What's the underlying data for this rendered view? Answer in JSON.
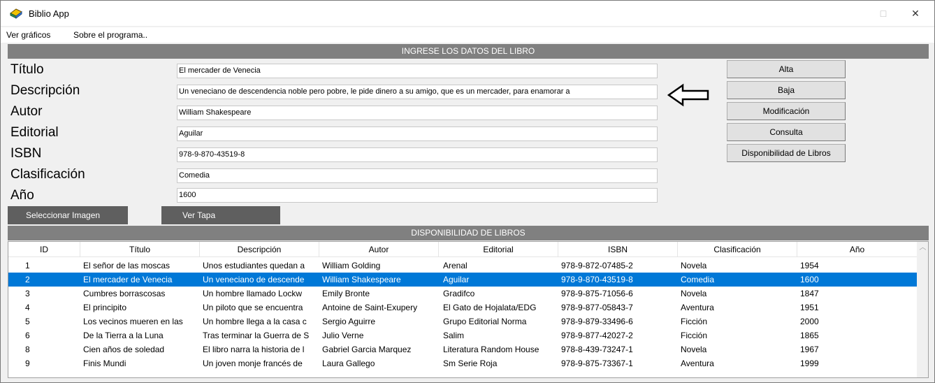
{
  "window": {
    "title": "Biblio App",
    "maximize_glyph": "□",
    "close_glyph": "✕"
  },
  "menu": [
    "Ver gráficos",
    "Sobre el programa.."
  ],
  "form": {
    "header": "INGRESE LOS DATOS DEL LIBRO",
    "fields": [
      {
        "label": "Título",
        "value": "El mercader de Venecia"
      },
      {
        "label": "Descripción",
        "value": "Un veneciano de descendencia noble pero pobre, le pide dinero a su amigo, que es un mercader, para enamorar a"
      },
      {
        "label": "Autor",
        "value": "William Shakespeare"
      },
      {
        "label": "Editorial",
        "value": "Aguilar"
      },
      {
        "label": "ISBN",
        "value": "978-9-870-43519-8"
      },
      {
        "label": "Clasificación",
        "value": "Comedia"
      },
      {
        "label": "Año",
        "value": "1600"
      }
    ],
    "actions": [
      "Alta",
      "Baja",
      "Modificación",
      "Consulta",
      "Disponibilidad de Libros"
    ],
    "select_image_label": "Seleccionar Imagen",
    "view_cover_label": "Ver Tapa"
  },
  "table": {
    "header": "DISPONIBILIDAD DE LIBROS",
    "columns": [
      "ID",
      "Título",
      "Descripción",
      "Autor",
      "Editorial",
      "ISBN",
      "Clasificación",
      "Año"
    ],
    "selected_index": 1,
    "rows": [
      [
        "1",
        "El señor de las moscas",
        "Unos estudiantes quedan a",
        "William Golding",
        "Arenal",
        "978-9-872-07485-2",
        "Novela",
        "1954"
      ],
      [
        "2",
        "El mercader de Venecia",
        "Un veneciano de descende",
        "William Shakespeare",
        "Aguilar",
        "978-9-870-43519-8",
        "Comedia",
        "1600"
      ],
      [
        "3",
        "Cumbres borrascosas",
        "Un hombre llamado Lockw",
        "Emily Bronte",
        "Gradifco",
        "978-9-875-71056-6",
        "Novela",
        "1847"
      ],
      [
        "4",
        "El principito",
        "Un piloto que se encuentra",
        "Antoine de Saint-Exupery",
        "El Gato de Hojalata/EDG",
        "978-9-877-05843-7",
        "Aventura",
        "1951"
      ],
      [
        "5",
        "Los vecinos mueren en las",
        "Un hombre llega a la casa c",
        "Sergio Aguirre",
        "Grupo Editorial Norma",
        "978-9-879-33496-6",
        "Ficción",
        "2000"
      ],
      [
        "6",
        "De la Tierra a la Luna",
        "Tras terminar la Guerra de S",
        "Julio Verne",
        "Salim",
        "978-9-877-42027-2",
        "Ficción",
        "1865"
      ],
      [
        "8",
        "Cien años de soledad",
        "El libro narra la historia de l",
        "Gabriel Garcia Marquez",
        "Literatura Random House",
        "978-8-439-73247-1",
        "Novela",
        "1967"
      ],
      [
        "9",
        "Finis Mundi",
        "Un joven monje francés de",
        "Laura Gallego",
        "Sm Serie Roja",
        "978-9-875-73367-1",
        "Aventura",
        "1999"
      ]
    ]
  },
  "colors": {
    "header_gray": "#808080",
    "selection_blue": "#0078d7",
    "dark_button": "#5f5f5f"
  }
}
